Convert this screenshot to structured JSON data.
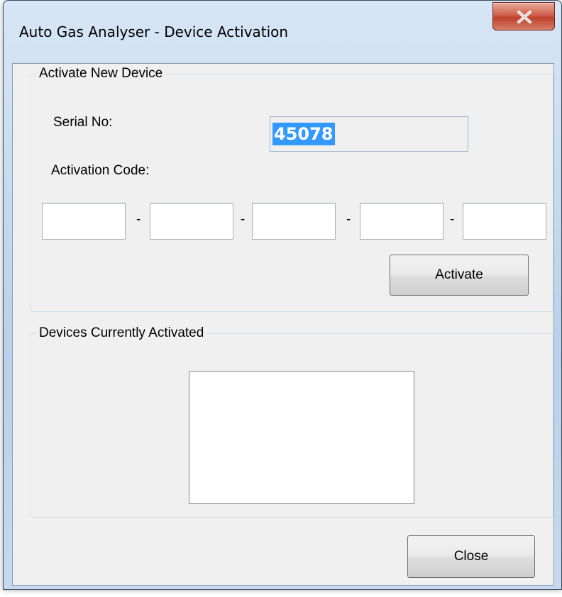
{
  "window": {
    "title": "Auto Gas Analyser - Device Activation",
    "close_icon": "close-x-icon"
  },
  "activate_group": {
    "title": "Activate New Device",
    "serial_label": "Serial No:",
    "serial_value": "45078",
    "activation_label": "Activation Code:",
    "code_fields": [
      "",
      "",
      "",
      "",
      ""
    ],
    "separator": "-",
    "activate_button": "Activate"
  },
  "devices_group": {
    "title": "Devices Currently Activated",
    "items": []
  },
  "footer": {
    "close_button": "Close"
  },
  "colors": {
    "selection_highlight": "#3399ff",
    "close_button_red": "#c0422c",
    "client_background": "#f0f0f0"
  }
}
